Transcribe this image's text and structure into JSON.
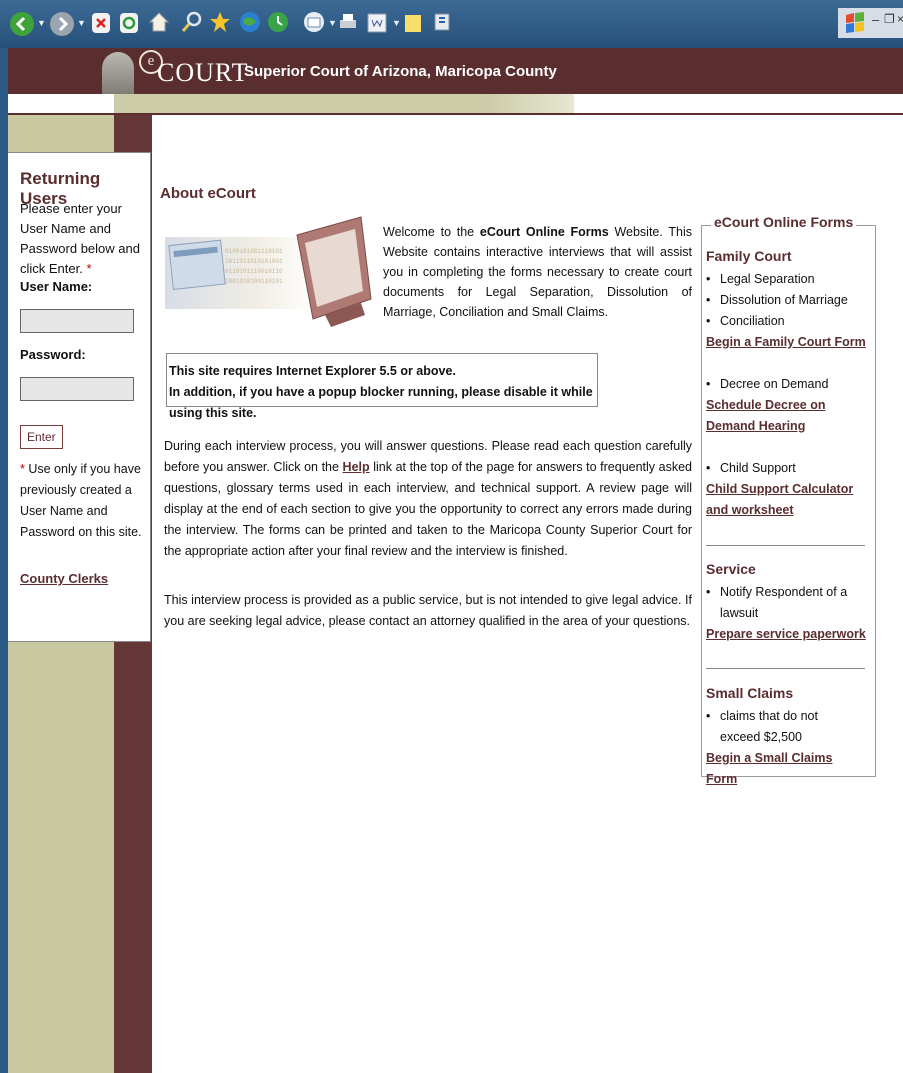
{
  "browser": {
    "toolbar_icons": [
      "back-icon",
      "forward-icon",
      "stop-icon",
      "refresh-icon",
      "home-icon",
      "search-icon",
      "favorites-icon",
      "media-icon",
      "history-icon",
      "mail-icon",
      "print-icon",
      "edit-icon",
      "discuss-icon",
      "messenger-icon"
    ]
  },
  "header": {
    "logo_text": "COURT",
    "logo_e": "e",
    "court_name": "Superior Court of Arizona, Maricopa County"
  },
  "login": {
    "heading": "Returning Users",
    "instructions": "Please enter your User Name and Password below and click Enter.",
    "required_mark": "*",
    "username_label": "User Name:",
    "password_label": "Password:",
    "enter_label": "Enter",
    "note_mark": "*",
    "note": " Use only if you have previously created a User Name and Password on this site.",
    "clerks_link": "County Clerks"
  },
  "main": {
    "title": "About eCourt",
    "welcome_prefix": "Welcome to the ",
    "welcome_bold": "eCourt Online Forms",
    "welcome_suffix": " Website. This Website contains interactive interviews that will assist you in completing the forms necessary to create court documents for Legal Separation, Dissolution of Marriage, Conciliation and Small Claims.",
    "requirement_1": "This site requires Internet Explorer 5.5 or above.",
    "requirement_2": "In addition, if you have a popup blocker running, please disable it while using this site.",
    "para1_a": "During each interview process, you will answer questions. Please read each question carefully before you answer. Click on the ",
    "para1_link": "Help",
    "para1_b": " link at the top of the page for answers to frequently asked questions, glossary terms used in each interview, and technical support. A review page will display at the end of each section to give you the opportunity to correct any errors made during the interview. The forms can be printed and taken to the Maricopa County Superior Court for the appropriate action after your final review and the interview is finished.",
    "para2": "This interview process is provided as a public service, but is not intended to give legal advice. If you are seeking legal advice, please contact an attorney qualified in the area of your questions."
  },
  "forms_panel": {
    "legend": "eCourt Online Forms",
    "family_title": "Family Court",
    "family_items": [
      "Legal Separation",
      "Dissolution of Marriage",
      "Conciliation"
    ],
    "family_link": "Begin a Family Court Form",
    "decree_item": "Decree on Demand",
    "decree_link": "Schedule Decree on Demand Hearing",
    "child_item": "Child Support",
    "child_link": "Child Support Calculator and worksheet",
    "service_title": "Service",
    "service_item": "Notify Respondent of a lawsuit",
    "service_link": "Prepare service paperwork",
    "small_title": "Small Claims",
    "small_item": "claims that do not exceed $2,500",
    "small_link": "Begin a Small Claims Form"
  }
}
